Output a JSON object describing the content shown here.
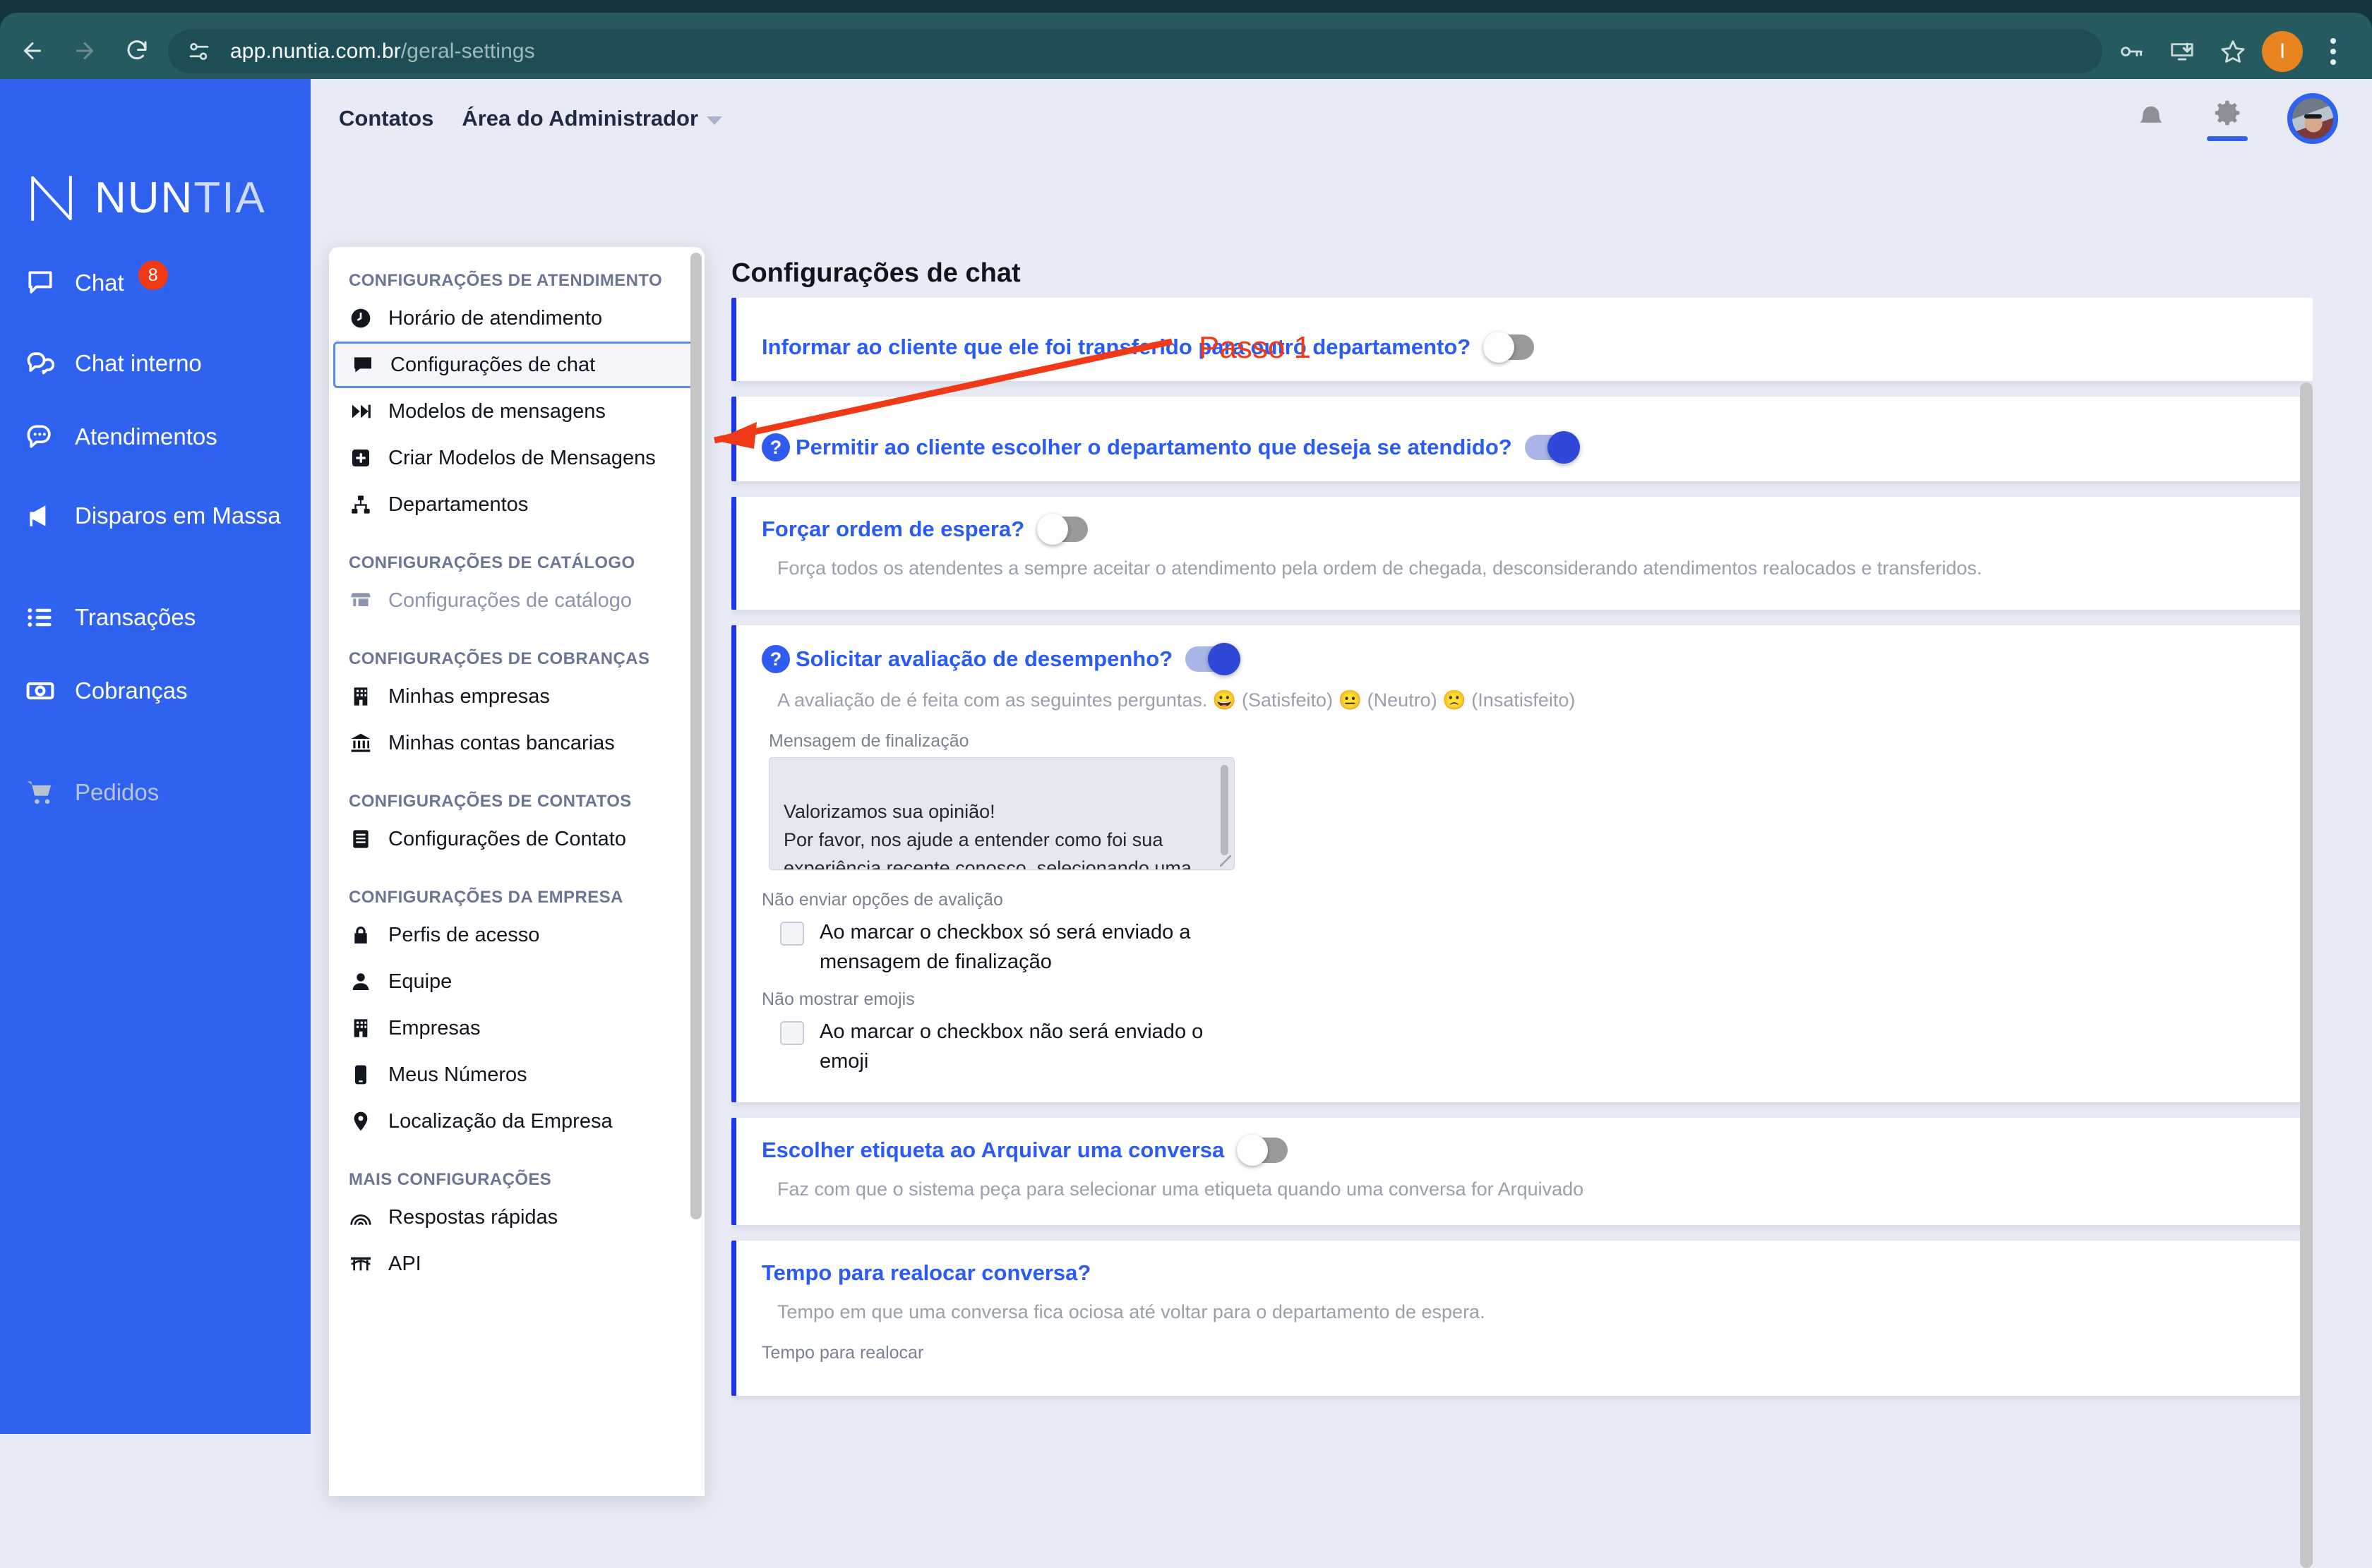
{
  "browser": {
    "url_host": "app.nuntia.com.br",
    "url_path": "/geral-settings",
    "back_icon": "back-arrow-icon",
    "forward_icon": "forward-arrow-icon",
    "reload_icon": "reload-icon",
    "site_info_icon": "site-settings-icon",
    "passwords_icon": "key-icon",
    "install_icon": "install-app-icon",
    "bookmark_icon": "star-icon",
    "profile_initial": "I",
    "menu_icon": "three-dot-menu-icon"
  },
  "sidebar": {
    "brand": {
      "name": "NUN",
      "name_light": "TIA"
    },
    "items": [
      {
        "label": "Chat",
        "icon": "chat-bubble-icon",
        "badge": "8",
        "disabled": false
      },
      {
        "label": "Chat interno",
        "icon": "chat-double-bubble-icon",
        "disabled": false
      },
      {
        "label": "Atendimentos",
        "icon": "chat-dots-icon",
        "disabled": false
      },
      {
        "label": "Disparos em Massa",
        "icon": "megaphone-icon",
        "disabled": false
      },
      {
        "label": "Transações",
        "icon": "list-icon",
        "disabled": false
      },
      {
        "label": "Cobranças",
        "icon": "banknote-icon",
        "disabled": false
      },
      {
        "label": "Pedidos",
        "icon": "shopping-cart-icon",
        "disabled": true
      }
    ]
  },
  "topbar": {
    "contatos": "Contatos",
    "admin_area": "Área do Administrador",
    "bell_icon": "bell-icon",
    "gear_icon": "gear-icon",
    "avatar": "user-avatar"
  },
  "settings_menu": {
    "sections": [
      {
        "title": "CONFIGURAÇÕES DE ATENDIMENTO",
        "items": [
          {
            "label": "Horário de atendimento",
            "icon": "clock-icon",
            "selected": false,
            "muted": false
          },
          {
            "label": "Configurações de chat",
            "icon": "chat-square-icon",
            "selected": true,
            "muted": false
          },
          {
            "label": "Modelos de mensagens",
            "icon": "skip-forward-icon",
            "selected": false,
            "muted": false
          },
          {
            "label": "Criar Modelos de Mensagens",
            "icon": "plus-square-icon",
            "selected": false,
            "muted": false
          },
          {
            "label": "Departamentos",
            "icon": "org-chart-icon",
            "selected": false,
            "muted": false
          }
        ]
      },
      {
        "title": "CONFIGURAÇÕES DE CATÁLOGO",
        "items": [
          {
            "label": "Configurações de catálogo",
            "icon": "storefront-icon",
            "selected": false,
            "muted": true
          }
        ]
      },
      {
        "title": "CONFIGURAÇÕES DE COBRANÇAS",
        "items": [
          {
            "label": "Minhas empresas",
            "icon": "building-icon",
            "selected": false,
            "muted": false
          },
          {
            "label": "Minhas contas bancarias",
            "icon": "bank-icon",
            "selected": false,
            "muted": false
          }
        ]
      },
      {
        "title": "CONFIGURAÇÕES DE CONTATOS",
        "items": [
          {
            "label": "Configurações de Contato",
            "icon": "address-book-icon",
            "selected": false,
            "muted": false
          }
        ]
      },
      {
        "title": "CONFIGURAÇÕES DA EMPRESA",
        "items": [
          {
            "label": "Perfis de acesso",
            "icon": "lock-icon",
            "selected": false,
            "muted": false
          },
          {
            "label": "Equipe",
            "icon": "person-icon",
            "selected": false,
            "muted": false
          },
          {
            "label": "Empresas",
            "icon": "building-icon",
            "selected": false,
            "muted": false
          },
          {
            "label": "Meus Números",
            "icon": "phone-icon",
            "selected": false,
            "muted": false
          },
          {
            "label": "Localização da Empresa",
            "icon": "map-pin-icon",
            "selected": false,
            "muted": false
          }
        ]
      },
      {
        "title": "MAIS CONFIGURAÇÕES",
        "items": [
          {
            "label": "Respostas rápidas",
            "icon": "rainbow-icon",
            "selected": false,
            "muted": false
          },
          {
            "label": "API",
            "icon": "bridge-icon",
            "selected": false,
            "muted": false
          }
        ]
      }
    ]
  },
  "main": {
    "page_title": "Configurações de chat",
    "cards": [
      {
        "id": "informar-transferencia",
        "title": "Informar ao cliente que ele foi transferido para outro departamento?",
        "has_help": false,
        "toggle": "off"
      },
      {
        "id": "escolher-departamento",
        "title": "Permitir ao cliente escolher o departamento que deseja se atendido?",
        "has_help": true,
        "help_glyph": "?",
        "toggle": "on"
      },
      {
        "id": "forcar-ordem-espera",
        "title": "Forçar ordem de espera?",
        "has_help": false,
        "toggle": "off",
        "description": "Força todos os atendentes a sempre aceitar o atendimento pela ordem de chegada, desconsiderando atendimentos realocados e transferidos."
      },
      {
        "id": "solicitar-avaliacao",
        "title": "Solicitar avaliação de desempenho?",
        "has_help": true,
        "help_glyph": "?",
        "toggle": "on",
        "description": "A avaliação de é feita com as seguintes perguntas. 😀 (Satisfeito) 😐 (Neutro) 🙁 (Insatisfeito)",
        "textarea_label": "Mensagem de finalização",
        "textarea_value": "Valorizamos sua opinião!\nPor favor, nos ajude a entender como foi sua experiência recente conosco, selecionando uma das opções abaixo:",
        "checkbox_1_label": "Não enviar opções de avalição",
        "checkbox_1_text": "Ao marcar o checkbox só será enviado a mensagem de finalização",
        "checkbox_1_checked": false,
        "checkbox_2_label": "Não mostrar emojis",
        "checkbox_2_text": "Ao marcar o checkbox não será enviado o emoji",
        "checkbox_2_checked": false
      },
      {
        "id": "escolher-etiqueta",
        "title": "Escolher etiqueta ao Arquivar uma conversa",
        "has_help": false,
        "toggle": "off",
        "description": "Faz com que o sistema peça para selecionar uma etiqueta quando uma conversa for Arquivado"
      },
      {
        "id": "tempo-realocar",
        "title": "Tempo para realocar conversa?",
        "has_help": false,
        "description": "Tempo em que uma conversa fica ociosa até voltar para o departamento de espera.",
        "field_label": "Tempo para realocar"
      }
    ]
  },
  "annotation": {
    "label": "Passo 1",
    "color": "#f03a17"
  }
}
